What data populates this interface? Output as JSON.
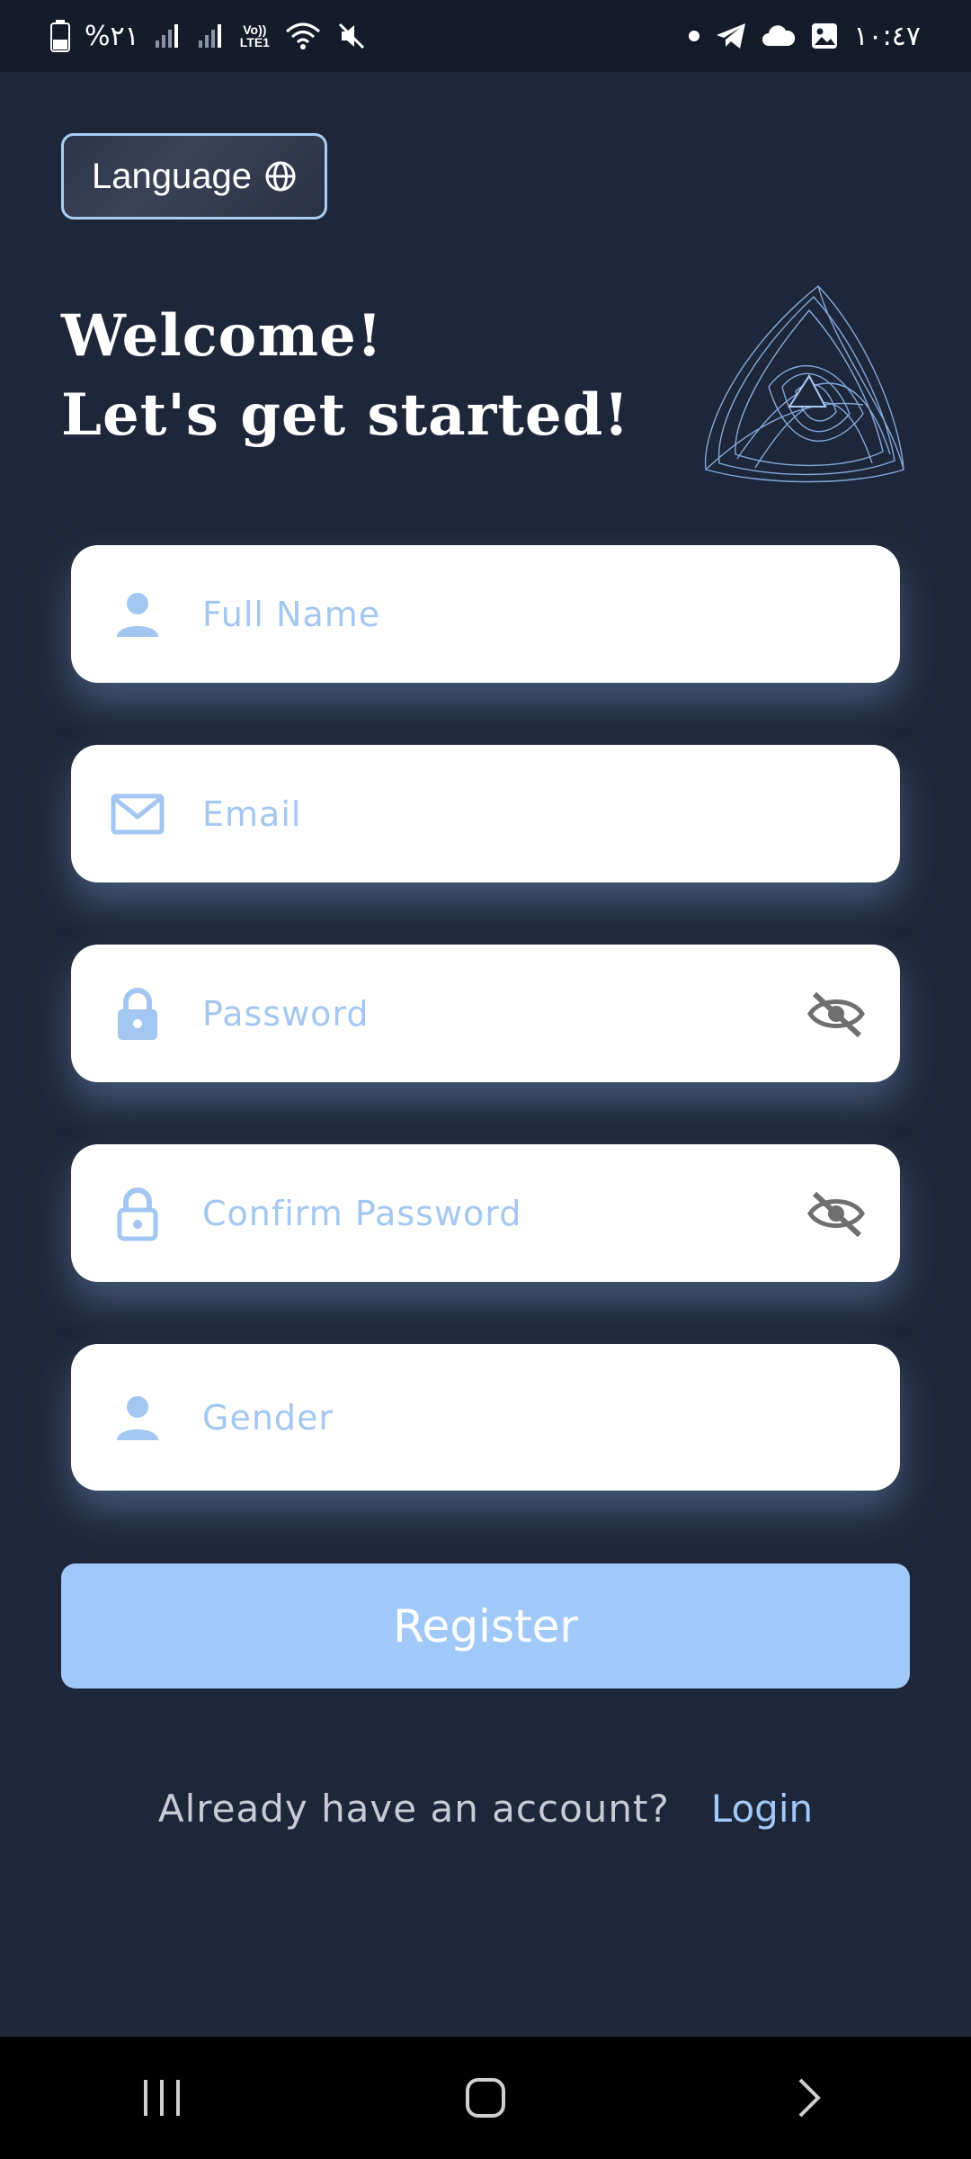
{
  "status_bar": {
    "battery_text": "%٢١",
    "network_label": "Vo))\nLTE1",
    "time": "١٠:٤٧"
  },
  "language_button": {
    "label": "Language",
    "icon": "globe-icon"
  },
  "headline": {
    "line1": "Welcome!",
    "line2": "Let's get started!"
  },
  "form": {
    "full_name": {
      "placeholder": "Full Name",
      "icon": "person-icon"
    },
    "email": {
      "placeholder": "Email",
      "icon": "mail-icon"
    },
    "password": {
      "placeholder": "Password",
      "icon": "lock-icon",
      "toggle_icon": "eye-off-icon"
    },
    "confirm_password": {
      "placeholder": "Confirm Password",
      "icon": "lock-outline-icon",
      "toggle_icon": "eye-off-icon"
    },
    "gender": {
      "placeholder": "Gender",
      "icon": "person-icon"
    }
  },
  "register_button": {
    "label": "Register"
  },
  "login_prompt": {
    "question": "Already have an account?",
    "link": "Login"
  },
  "colors": {
    "background": "#1e2639",
    "accent": "#a0c9fa",
    "placeholder": "#a4c7f1",
    "icon_blue": "#a4c7f1"
  }
}
